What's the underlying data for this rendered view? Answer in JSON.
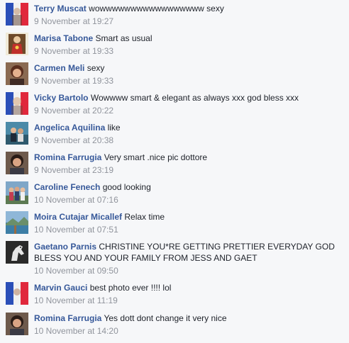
{
  "comments": [
    {
      "author": "Terry Muscat",
      "text": "wowwwwwwwwwwwwwwwww sexy",
      "time": "9 November at 19:27",
      "avatar": "french-flag-avatar"
    },
    {
      "author": "Marisa Tabone",
      "text": "Smart as usual",
      "time": "9 November at 19:33",
      "avatar": "sacred-heart-avatar"
    },
    {
      "author": "Carmen Meli",
      "text": "sexy",
      "time": "9 November at 19:33",
      "avatar": "woman-portrait-avatar"
    },
    {
      "author": "Vicky Bartolo",
      "text": "Wowwww smart & elegant as always xxx god bless xxx",
      "time": "9 November at 20:22",
      "avatar": "french-flag-avatar"
    },
    {
      "author": "Angelica Aquilina",
      "text": "like",
      "time": "9 November at 20:38",
      "avatar": "people-photo-avatar"
    },
    {
      "author": "Romina Farrugia",
      "text": "Very smart .nice pic dottore",
      "time": "9 November at 23:19",
      "avatar": "woman-portrait-avatar"
    },
    {
      "author": "Caroline Fenech",
      "text": "good looking",
      "time": "10 November at 07:16",
      "avatar": "group-photo-avatar"
    },
    {
      "author": "Moira Cutajar Micallef",
      "text": "Relax time",
      "time": "10 November at 07:51",
      "avatar": "landscape-avatar"
    },
    {
      "author": "Gaetano Parnis",
      "text": "CHRISTINE YOU*RE GETTING PRETTIER EVERYDAY GOD BLESS YOU AND YOUR FAMILY FROM JESS AND GAET",
      "time": "10 November at 09:50",
      "avatar": "horse-avatar"
    },
    {
      "author": "Marvin Gauci",
      "text": "best photo ever !!!! lol",
      "time": "10 November at 11:19",
      "avatar": "french-flag-avatar"
    },
    {
      "author": "Romina Farrugia",
      "text": "Yes dott dont change it very nice",
      "time": "10 November at 14:20",
      "avatar": "woman-portrait-avatar"
    }
  ],
  "colors": {
    "author": "#365899",
    "timestamp": "#90949c",
    "text": "#1d2129",
    "background": "#f6f7f9"
  }
}
